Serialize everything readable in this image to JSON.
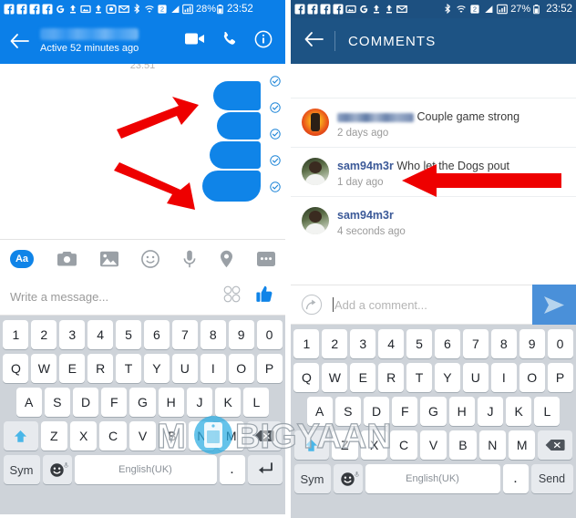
{
  "left": {
    "statusbar": {
      "icons": [
        "facebook-icon",
        "facebook-icon",
        "facebook-icon",
        "facebook-icon",
        "google-icon",
        "upload-icon",
        "photo-icon",
        "upload-icon",
        "instagram-icon",
        "mail-icon",
        "bluetooth-icon",
        "wifi-icon",
        "sim-icon",
        "signal-icon",
        "signal-bars-icon"
      ],
      "battery": "28%",
      "time": "23:52"
    },
    "header": {
      "back": "back-arrow",
      "contact_name": "",
      "status": "Active 52 minutes ago",
      "actions": [
        "video-call-icon",
        "voice-call-icon",
        "info-icon"
      ]
    },
    "thread": {
      "timestamp": "23:51",
      "bubbles": [
        {
          "id": "bubble-1",
          "text": ""
        },
        {
          "id": "bubble-2",
          "text": ""
        },
        {
          "id": "bubble-3",
          "text": ""
        },
        {
          "id": "bubble-4",
          "text": ""
        }
      ],
      "delivery_ticks": 5
    },
    "tools": [
      "text-format-icon",
      "camera-icon",
      "gallery-icon",
      "sticker-icon",
      "voice-icon",
      "location-icon",
      "more-icon"
    ],
    "tools_aa_label": "Aa",
    "composer": {
      "placeholder": "Write a message...",
      "emoji_icon": "emoji-grid-icon",
      "like_icon": "thumbs-up-icon"
    }
  },
  "right": {
    "statusbar": {
      "icons": [
        "facebook-icon",
        "facebook-icon",
        "facebook-icon",
        "facebook-icon",
        "photo-icon",
        "google-icon",
        "upload-icon",
        "upload-icon",
        "mail-icon",
        "bluetooth-icon",
        "wifi-icon",
        "sim-icon",
        "signal-icon",
        "signal-bars-icon"
      ],
      "battery": "27%",
      "time": "23:52"
    },
    "header": {
      "back": "back-arrow",
      "title": "COMMENTS"
    },
    "comments": [
      {
        "user": "",
        "user_blurred": true,
        "text": "Couple game strong",
        "time": "2 days ago",
        "avatar": "avatar-orange"
      },
      {
        "user": "sam94m3r",
        "user_blurred": false,
        "text": "Who let the Dogs pout",
        "time": "1 day ago",
        "avatar": "avatar-person"
      },
      {
        "user": "sam94m3r",
        "user_blurred": false,
        "text": "",
        "time": "4 seconds ago",
        "avatar": "avatar-person"
      }
    ],
    "composer": {
      "share_icon": "share-arrow-icon",
      "placeholder": "Add a comment...",
      "send_icon": "send-icon"
    }
  },
  "keyboard": {
    "row_numbers": [
      "1",
      "2",
      "3",
      "4",
      "5",
      "6",
      "7",
      "8",
      "9",
      "0"
    ],
    "row_top": [
      "Q",
      "W",
      "E",
      "R",
      "T",
      "Y",
      "U",
      "I",
      "O",
      "P"
    ],
    "row_home": [
      "A",
      "S",
      "D",
      "F",
      "G",
      "H",
      "J",
      "K",
      "L"
    ],
    "row_bottom": [
      "Z",
      "X",
      "C",
      "V",
      "B",
      "N",
      "M"
    ],
    "shift": "shift-icon",
    "delete": "backspace-icon",
    "sym_label": "Sym",
    "emoji_label": "emoji-icon",
    "space_label": "English(UK)",
    "dot_label": ".",
    "enter_left": "enter-icon",
    "enter_right": "Send"
  },
  "watermark": {
    "text_a": "M",
    "text_b": "BIGYAAN",
    "logo": "phone-logo-icon"
  },
  "colors": {
    "messenger_blue": "#0b7fe8",
    "comments_header_blue": "#1d5384",
    "bubble_blue": "#0f84e8",
    "send_blue": "#4a90d9",
    "arrow_red": "#ee0000",
    "keyboard_bg": "#ced3d9",
    "username_blue": "#3b5998"
  }
}
